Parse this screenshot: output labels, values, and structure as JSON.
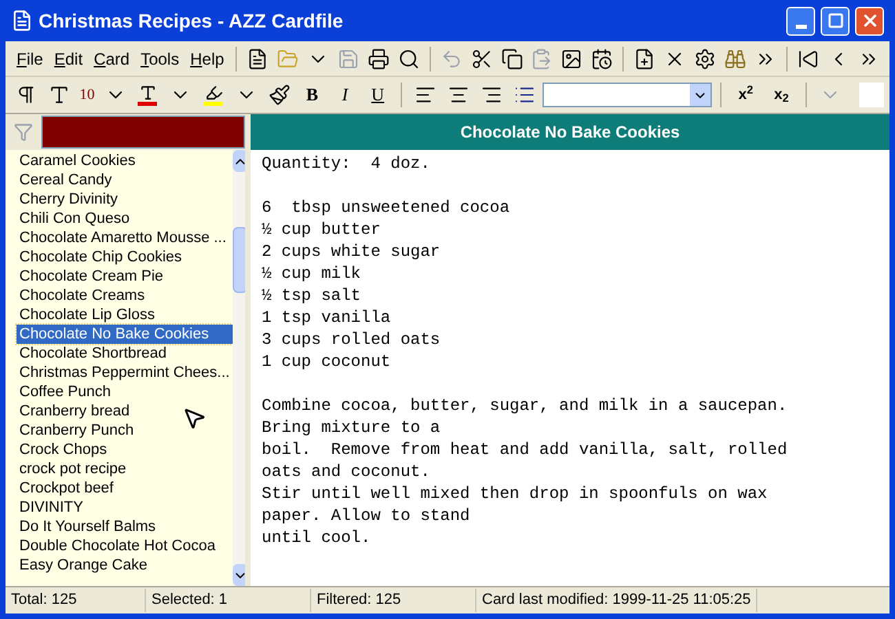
{
  "window": {
    "title": "Christmas Recipes - AZZ Cardfile"
  },
  "menu": [
    "File",
    "Edit",
    "Card",
    "Tools",
    "Help"
  ],
  "format_toolbar": {
    "font_size": "10",
    "bold": "B",
    "italic": "I",
    "underline": "U",
    "superscript": "x$^{2}$",
    "subscript": "x$_{2}$"
  },
  "filter": {
    "color": "#800000"
  },
  "cards": [
    {
      "title": "Caramel Cookies",
      "selected": false
    },
    {
      "title": "Cereal Candy",
      "selected": false
    },
    {
      "title": "Cherry Divinity",
      "selected": false
    },
    {
      "title": "Chili Con Queso",
      "selected": false
    },
    {
      "title": "Chocolate Amaretto Mousse ...",
      "selected": false
    },
    {
      "title": "Chocolate Chip Cookies",
      "selected": false
    },
    {
      "title": "Chocolate Cream Pie",
      "selected": false
    },
    {
      "title": "Chocolate Creams",
      "selected": false
    },
    {
      "title": "Chocolate Lip Gloss",
      "selected": false
    },
    {
      "title": "Chocolate No Bake Cookies",
      "selected": true
    },
    {
      "title": "Chocolate Shortbread",
      "selected": false
    },
    {
      "title": "Christmas Peppermint Chees...",
      "selected": false
    },
    {
      "title": "Coffee Punch",
      "selected": false
    },
    {
      "title": "Cranberry bread",
      "selected": false
    },
    {
      "title": "Cranberry Punch",
      "selected": false
    },
    {
      "title": "Crock Chops",
      "selected": false
    },
    {
      "title": "crock pot recipe",
      "selected": false
    },
    {
      "title": "Crockpot beef",
      "selected": false
    },
    {
      "title": "DIVINITY",
      "selected": false
    },
    {
      "title": "Do It Yourself Balms",
      "selected": false
    },
    {
      "title": "Double Chocolate Hot Cocoa",
      "selected": false
    },
    {
      "title": "Easy Orange Cake",
      "selected": false
    }
  ],
  "card": {
    "title": "Chocolate No Bake Cookies",
    "paragraphs": [
      [
        "Quantity:  4 doz."
      ],
      [
        "6  tbsp unsweetened cocoa",
        "½ cup butter",
        "2 cups white sugar",
        "½ cup milk",
        "½ tsp salt",
        "1 tsp vanilla",
        "3 cups rolled oats",
        "1 cup coconut"
      ],
      [
        "Combine cocoa, butter, sugar, and milk in a saucepan.",
        "Bring mixture to a",
        "boil.  Remove from heat and add vanilla, salt, rolled",
        "oats and coconut.",
        "Stir until well mixed then drop in spoonfuls on wax",
        "paper. Allow to stand",
        "until cool."
      ]
    ]
  },
  "status_bar": [
    "Total: 125",
    "Selected: 1",
    "Filtered: 125",
    "Card last modified: 1999-11-25  11:05:25"
  ]
}
